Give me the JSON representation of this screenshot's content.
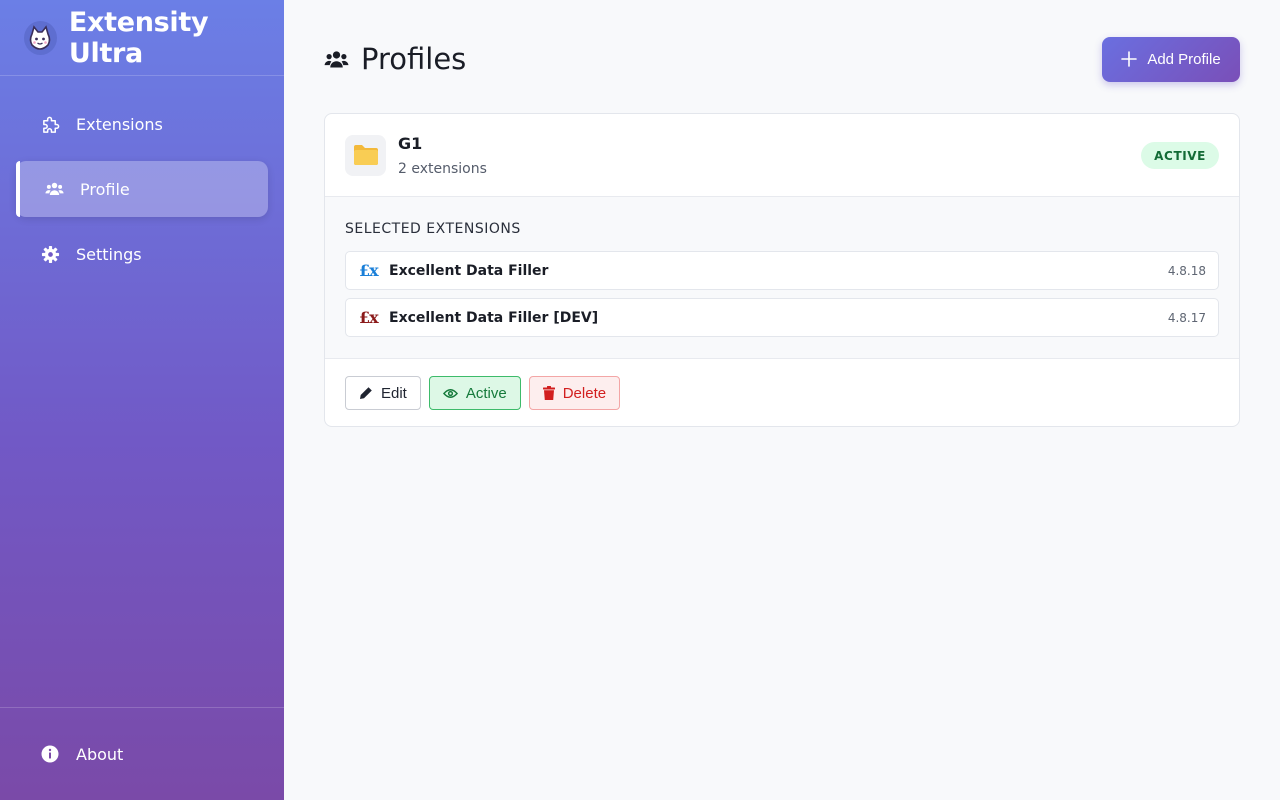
{
  "app": {
    "title": "Extensity Ultra"
  },
  "sidebar": {
    "items": [
      {
        "label": "Extensions",
        "icon": "puzzle-icon",
        "active": false
      },
      {
        "label": "Profile",
        "icon": "users-icon",
        "active": true
      },
      {
        "label": "Settings",
        "icon": "gear-icon",
        "active": false
      }
    ],
    "footer": {
      "label": "About",
      "icon": "info-icon"
    }
  },
  "header": {
    "title": "Profiles",
    "add_label": "Add Profile"
  },
  "profile": {
    "name": "G1",
    "count": "2 extensions",
    "status": "ACTIVE",
    "section_title": "SELECTED EXTENSIONS",
    "extensions": [
      {
        "icon_text": "£x",
        "icon_color": "#1a7fd8",
        "name": "Excellent Data Filler",
        "version": "4.8.18"
      },
      {
        "icon_text": "£x",
        "icon_color": "#8b1a1a",
        "name": "Excellent Data Filler [DEV]",
        "version": "4.8.17"
      }
    ],
    "actions": {
      "edit": "Edit",
      "active": "Active",
      "delete": "Delete"
    }
  },
  "colors": {
    "accent": "#6a6fe0",
    "success": "#157a3b",
    "danger": "#d21f1f",
    "folder": "#f7c548"
  }
}
